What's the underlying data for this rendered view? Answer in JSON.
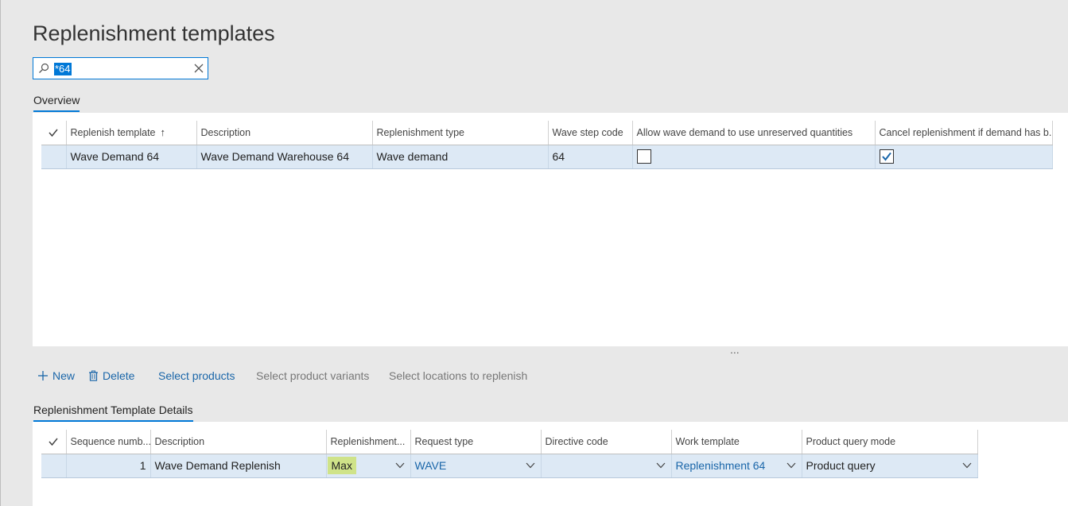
{
  "page": {
    "title": "Replenishment templates"
  },
  "filter": {
    "value": "*64"
  },
  "overview": {
    "tab_label": "Overview",
    "columns": [
      "Replenish template",
      "Description",
      "Replenishment type",
      "Wave step code",
      "Allow wave demand to use unreserved quantities",
      "Cancel replenishment if demand has b..."
    ],
    "sort_indicator": "↑",
    "rows": [
      {
        "template": "Wave Demand 64",
        "description": "Wave Demand Warehouse 64",
        "type": "Wave demand",
        "wave_step_code": "64",
        "allow_unreserved": false,
        "cancel_replenishment": true
      }
    ]
  },
  "splitter": {
    "label": "..."
  },
  "toolbar": {
    "new_label": "New",
    "delete_label": "Delete",
    "select_products_label": "Select products",
    "select_variants_label": "Select product variants",
    "select_locations_label": "Select locations to replenish"
  },
  "details": {
    "tab_label": "Replenishment Template Details",
    "columns": [
      "Sequence numb...",
      "Description",
      "Replenishment...",
      "Request type",
      "Directive code",
      "Work template",
      "Product query mode"
    ],
    "rows": [
      {
        "sequence": "1",
        "description": "Wave Demand Replenish",
        "replenishment": "Max",
        "request_type": "WAVE",
        "directive_code": "",
        "work_template": "Replenishment 64",
        "product_query_mode": "Product query"
      }
    ]
  },
  "colors": {
    "accent": "#0078d7",
    "link": "#1a66a9",
    "selected_row": "#dde9f5",
    "highlight": "#cfe389",
    "page_bg": "#e8e8e8"
  }
}
